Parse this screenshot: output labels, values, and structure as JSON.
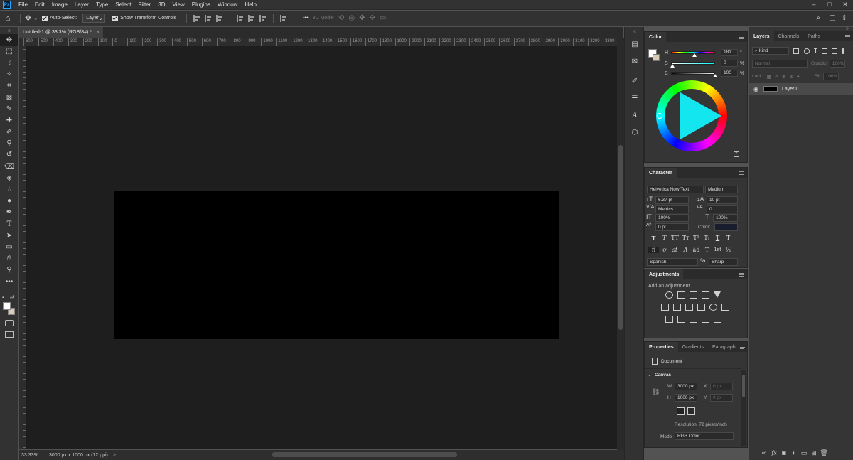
{
  "app": {
    "logo": "Ps"
  },
  "menu": [
    "File",
    "Edit",
    "Image",
    "Layer",
    "Type",
    "Select",
    "Filter",
    "3D",
    "View",
    "Plugins",
    "Window",
    "Help"
  ],
  "window_controls": [
    "–",
    "□",
    "✕"
  ],
  "options": {
    "auto_select_label": "Auto-Select:",
    "auto_select_value": "Layer",
    "show_transform_label": "Show Transform Controls",
    "more": "•••",
    "mode_3d": "3D Mode:"
  },
  "tab": {
    "title": "Untitled-1 @ 33.3% (RGB/8#) *",
    "close": "×"
  },
  "ruler_labels": [
    "600",
    "500",
    "400",
    "300",
    "200",
    "100",
    "0",
    "100",
    "200",
    "300",
    "400",
    "500",
    "600",
    "700",
    "800",
    "900",
    "1000",
    "1100",
    "1200",
    "1300",
    "1400",
    "1500",
    "1600",
    "1700",
    "1800",
    "1900",
    "2000",
    "2100",
    "2200",
    "2300",
    "2400",
    "2500",
    "2600",
    "2700",
    "2800",
    "2900",
    "3000",
    "3100",
    "3200",
    "3300"
  ],
  "status": {
    "zoom": "33.33%",
    "doc_info": "3000 px x 1000 px (72 ppi)",
    "arrow": ">"
  },
  "color_panel": {
    "title": "Color",
    "h_label": "H",
    "h_value": "181",
    "h_unit": "°",
    "s_label": "S",
    "s_value": "0",
    "s_unit": "%",
    "b_label": "B",
    "b_value": "100",
    "b_unit": "%",
    "fg": "#ffffff",
    "bg": "#d8ccb5"
  },
  "character_panel": {
    "title": "Character",
    "font_family": "Helvetica Now Text",
    "font_style": "Medium",
    "size": "6.37 pt",
    "leading": "10 pt",
    "kerning": "Metrics",
    "tracking": "0",
    "vscale": "100%",
    "hscale": "100%",
    "baseline": "0 pt",
    "color_label": "Color:",
    "language": "Spanish",
    "antialias": "Sharp",
    "fmt_row1": [
      "T",
      "T",
      "TT",
      "Tт",
      "T¹",
      "T₁",
      "T",
      "Ŧ"
    ],
    "fmt_row2": [
      "fi",
      "ơ",
      "st",
      "A",
      "ād",
      "T",
      "1st",
      "½"
    ]
  },
  "adjustments_panel": {
    "title": "Adjustments",
    "hint": "Add an adjustment"
  },
  "properties_panel": {
    "tabs": [
      "Properties",
      "Gradients",
      "Paragraph"
    ],
    "doc_label": "Document",
    "canvas_label": "Canvas",
    "w_label": "W",
    "w_value": "3000 px",
    "h_label": "H",
    "h_value": "1000 px",
    "x_label": "X",
    "x_value": "0 px",
    "y_label": "Y",
    "y_value": "0 px",
    "resolution": "Resolution: 72 pixels/inch",
    "mode_label": "Mode",
    "mode_value": "RGB Color"
  },
  "layers_panel": {
    "tabs": [
      "Layers",
      "Channels",
      "Paths"
    ],
    "filter": "Kind",
    "blend": "Normal",
    "opacity_label": "Opacity:",
    "opacity_value": "100%",
    "lock_label": "Lock:",
    "fill_label": "Fill:",
    "fill_value": "100%",
    "layers": [
      {
        "name": "Layer 0"
      }
    ],
    "footer_icons": [
      "link-icon",
      "fx-icon",
      "mask-icon",
      "adjustment-icon",
      "group-icon",
      "new-layer-icon",
      "trash-icon"
    ]
  }
}
